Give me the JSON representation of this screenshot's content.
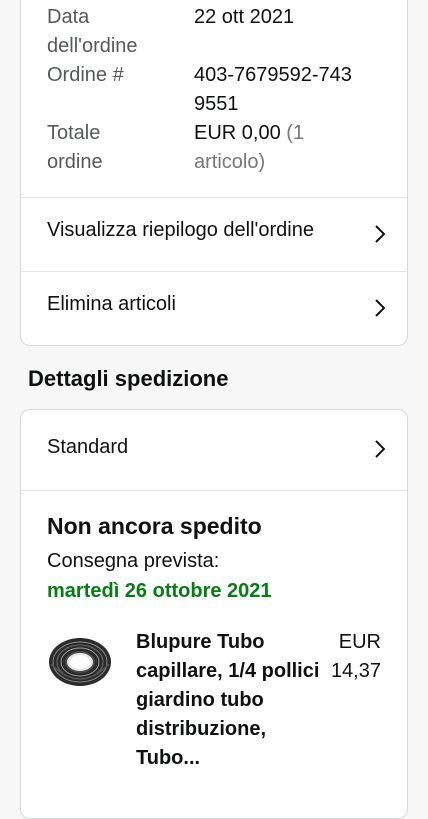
{
  "order_summary": {
    "date_label": "Data dell'ordine",
    "date_value": "22 ott 2021",
    "number_label": "Ordine #",
    "number_value": "403-7679592-7439551",
    "total_label": "Totale ordine",
    "total_value": "EUR 0,00",
    "total_items": "(1 articolo)"
  },
  "actions": {
    "view_summary": "Visualizza riepilogo dell'ordine",
    "delete_items": "Elimina articoli"
  },
  "shipping": {
    "section_title": "Dettagli spedizione",
    "method": "Standard",
    "status": "Non ancora spedito",
    "delivery_label": "Consegna prevista:",
    "delivery_date": "martedì 26 ottobre 2021"
  },
  "product": {
    "title": "Blupure Tubo capillare, 1/4 pollici giardino tubo distribuzione, Tubo...",
    "price_currency": "EUR",
    "price_value": "14,37"
  },
  "colors": {
    "delivery_date": "#067d14",
    "card_border": "#d5d9d9"
  }
}
